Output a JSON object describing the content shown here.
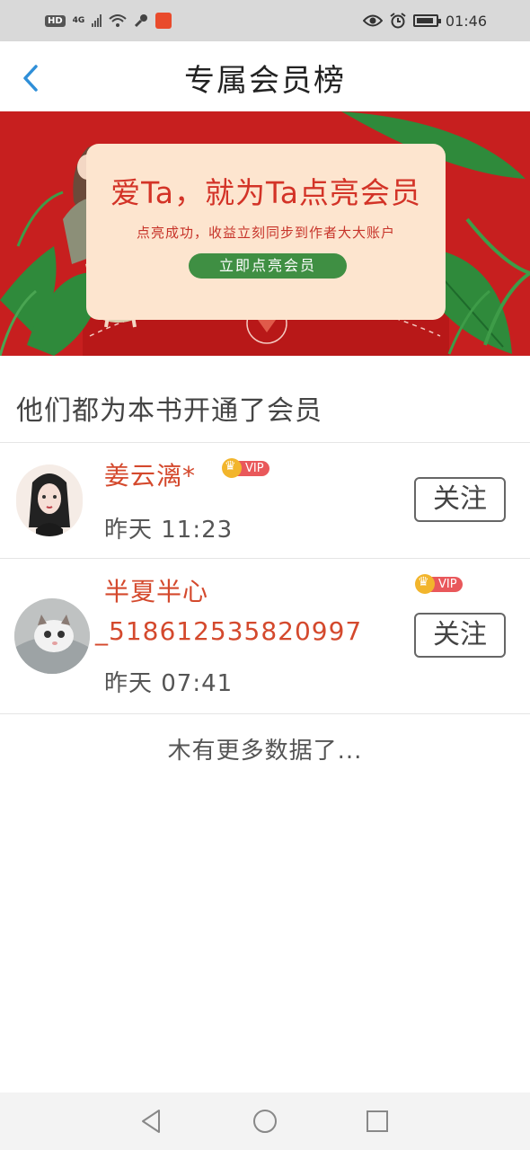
{
  "status_bar": {
    "hd": "HD",
    "network": "4G",
    "time": "01:46",
    "icons": [
      "hd-icon",
      "signal-icon",
      "wifi-icon",
      "key-icon",
      "app-notification-icon",
      "eye-icon",
      "alarm-icon",
      "battery-icon"
    ]
  },
  "header": {
    "title": "专属会员榜",
    "back_icon": "chevron-left-icon"
  },
  "banner": {
    "headline": "爱Ta，就为Ta点亮会员",
    "subtitle": "点亮成功，收益立刻同步到作者大大账户",
    "button_label": "立即点亮会员",
    "colors": {
      "background": "#c71f1f",
      "card": "#fde5cf",
      "button": "#3f8f43",
      "accent": "#d33327"
    }
  },
  "section": {
    "title": "他们都为本书开通了会员"
  },
  "members": [
    {
      "name": "姜云漓*",
      "vip_label": "VIP",
      "time": "昨天 11:23",
      "follow_label": "关注"
    },
    {
      "name_line1": "半夏半心",
      "name_line2": "_518612535820997",
      "vip_label": "VIP",
      "time": "昨天 07:41",
      "follow_label": "关注"
    }
  ],
  "footer_text": "木有更多数据了...",
  "nav": {
    "icons": [
      "back-triangle-icon",
      "home-circle-icon",
      "recents-square-icon"
    ]
  }
}
